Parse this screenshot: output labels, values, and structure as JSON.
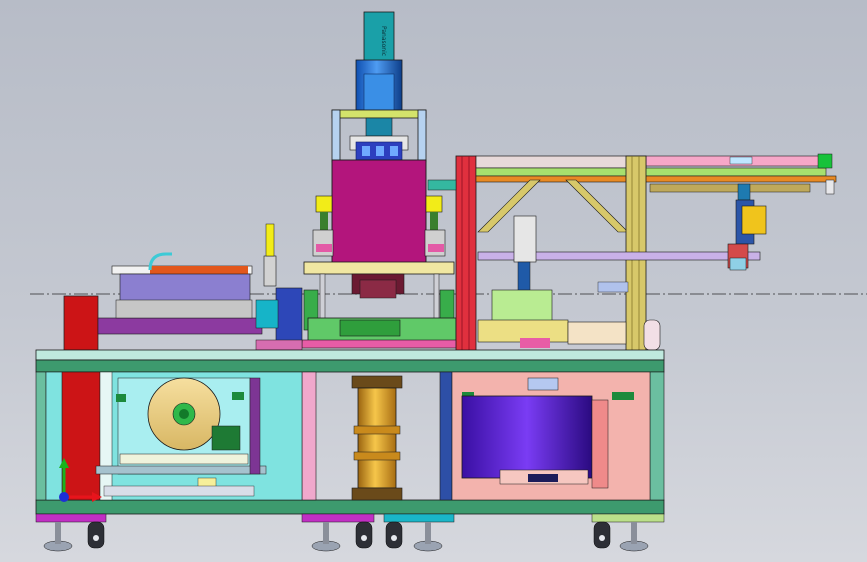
{
  "viewport": {
    "background_top": "#b7bcc7",
    "background_bottom": "#d6d8de"
  },
  "motor": {
    "brand_text": "Panasonic"
  },
  "triad": {
    "x_color": "#e8141c",
    "y_color": "#19b31b",
    "z_color": "#1d2fd6"
  },
  "colors": {
    "frame": "#3d9a6e",
    "magenta_block": "#b3157c",
    "cylinder": "#e1a328",
    "drum": "#5b14d4",
    "cabinet_left": "#7fe3e0",
    "cabinet_right": "#f3b3ad",
    "red_column": "#cc1416",
    "gantry_beam": "#d7c86a"
  }
}
